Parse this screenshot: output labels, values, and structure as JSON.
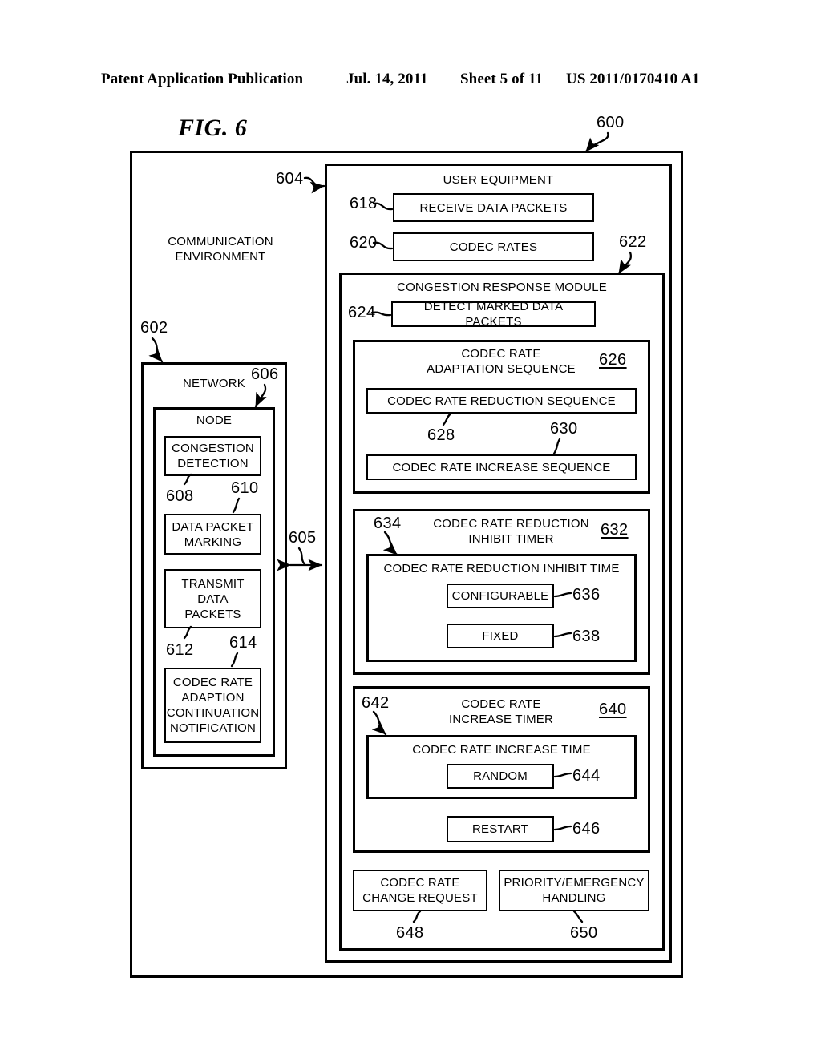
{
  "header": {
    "publication": "Patent Application Publication",
    "date": "Jul. 14, 2011",
    "sheet": "Sheet 5 of 11",
    "patent_number": "US 2011/0170410 A1"
  },
  "figure": {
    "label": "FIG. 6",
    "overall_ref": "600"
  },
  "communication_environment": {
    "title": "COMMUNICATION\nENVIRONMENT",
    "ref": "602"
  },
  "interface": {
    "ref": "605"
  },
  "network": {
    "title": "NETWORK",
    "ref": "606",
    "node": {
      "title": "NODE",
      "items": [
        {
          "label": "CONGESTION\nDETECTION",
          "ref": "608"
        },
        {
          "label": "DATA PACKET\nMARKING",
          "ref": "610"
        },
        {
          "label": "TRANSMIT\nDATA\nPACKETS",
          "ref": "612"
        },
        {
          "label": "CODEC RATE\nADAPTION\nCONTINUATION\nNOTIFICATION",
          "ref": "614"
        }
      ]
    }
  },
  "user_equipment": {
    "title": "USER EQUIPMENT",
    "ref": "604",
    "receive_data_packets": {
      "label": "RECEIVE DATA PACKETS",
      "ref": "618"
    },
    "codec_rates": {
      "label": "CODEC RATES",
      "ref": "620"
    },
    "congestion_response_module": {
      "title": "CONGESTION RESPONSE MODULE",
      "ref": "622",
      "detect_marked_data_packets": {
        "label": "DETECT MARKED DATA PACKETS",
        "ref": "624"
      },
      "adaptation_sequence": {
        "title": "CODEC RATE\nADAPTATION SEQUENCE",
        "ref": "626",
        "reduction_sequence": {
          "label": "CODEC RATE REDUCTION SEQUENCE",
          "ref": "628"
        },
        "increase_sequence": {
          "label": "CODEC RATE INCREASE SEQUENCE",
          "ref": "630"
        }
      },
      "reduction_inhibit_timer": {
        "title": "CODEC RATE REDUCTION\nINHIBIT TIMER",
        "ref": "632",
        "inhibit_time": {
          "label": "CODEC RATE REDUCTION INHIBIT TIME",
          "ref": "634"
        },
        "configurable": {
          "label": "CONFIGURABLE",
          "ref": "636"
        },
        "fixed": {
          "label": "FIXED",
          "ref": "638"
        }
      },
      "increase_timer": {
        "title": "CODEC RATE\nINCREASE TIMER",
        "ref": "640",
        "increase_time": {
          "label": "CODEC RATE INCREASE TIME",
          "ref": "642"
        },
        "random": {
          "label": "RANDOM",
          "ref": "644"
        },
        "restart": {
          "label": "RESTART",
          "ref": "646"
        }
      },
      "change_request": {
        "label": "CODEC RATE\nCHANGE REQUEST",
        "ref": "648"
      },
      "priority_handling": {
        "label": "PRIORITY/EMERGENCY\nHANDLING",
        "ref": "650"
      }
    }
  }
}
